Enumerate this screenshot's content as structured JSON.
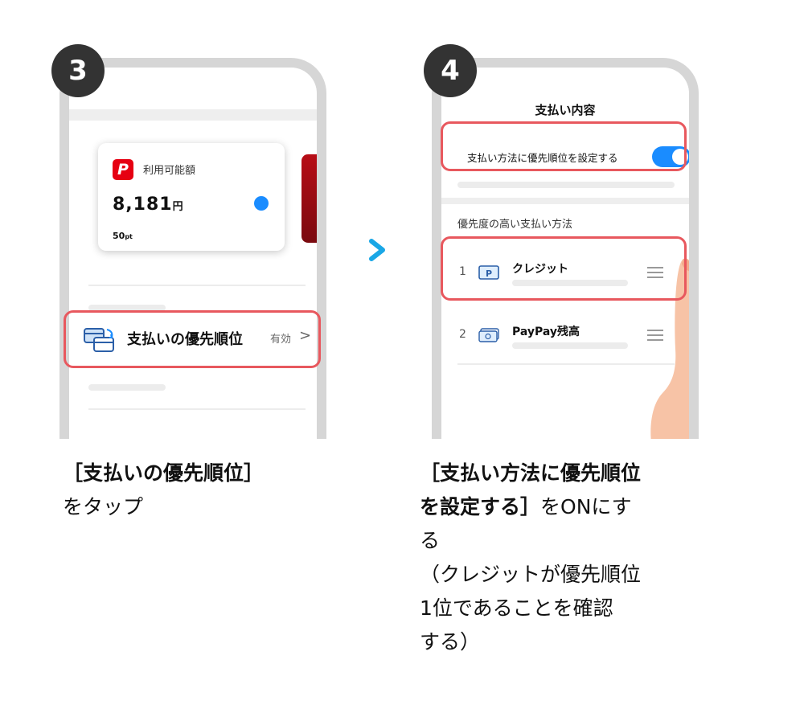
{
  "steps": [
    {
      "badge": "3",
      "screen": {
        "card": {
          "label": "利用可能額",
          "amount": "8,181",
          "currency": "円",
          "points_value": "50",
          "points_unit": "pt"
        },
        "priority_row": {
          "label": "支払いの優先順位",
          "status": "有効",
          "chevron": ">"
        }
      },
      "caption": {
        "bold": "［支払いの優先順位］",
        "normal": "をタップ"
      }
    },
    {
      "badge": "4",
      "screen": {
        "title": "支払い内容",
        "toggle": {
          "label": "支払い方法に優先順位を設定する",
          "state": "on"
        },
        "section_title": "優先度の高い支払い方法",
        "methods": [
          {
            "rank": "1",
            "name": "クレジット",
            "icon": "credit-card-icon"
          },
          {
            "rank": "2",
            "name": "PayPay残高",
            "icon": "cash-icon"
          }
        ]
      },
      "caption": {
        "line1": "［支払い方法に優先順位",
        "line2_bold": "を設定する］",
        "line2_normal": "をONにす",
        "line3": "る",
        "line4": "（クレジットが優先順位",
        "line5": "1位であることを確認",
        "line6": "する）"
      }
    }
  ],
  "colors": {
    "accent": "#1a8cff",
    "highlight": "#e8585e",
    "brand_red": "#e60012",
    "arrow": "#1aa7e6"
  }
}
